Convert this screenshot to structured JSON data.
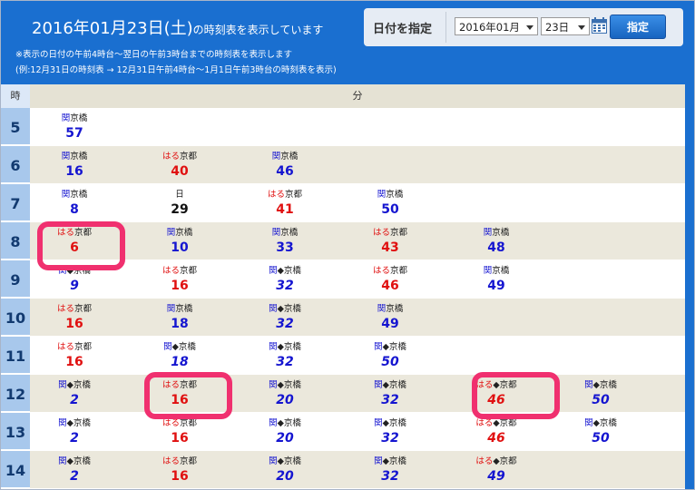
{
  "header": {
    "title_date": "2016年01月23日(土)",
    "title_suffix": "の時刻表を表示しています",
    "note1": "※表示の日付の午前4時台～翌日の午前3時台までの時刻表を表示します",
    "note2": "(例:12月31日の時刻表 → 12月31日午前4時台～1月1日午前3時台の時刻表を表示)"
  },
  "date_picker": {
    "label": "日付を指定",
    "month_value": "2016年01月",
    "day_value": "23日",
    "button_label": "指定"
  },
  "table": {
    "hour_header": "時",
    "minute_header": "分",
    "rows": [
      {
        "hour": "5",
        "entries": [
          {
            "label": "関京橋",
            "minute": "57",
            "label_type": "kansai",
            "minute_color": "blue",
            "italic": false
          }
        ]
      },
      {
        "hour": "6",
        "entries": [
          {
            "label": "関京橋",
            "minute": "16",
            "label_type": "kansai",
            "minute_color": "blue",
            "italic": false
          },
          {
            "label": "はる京都",
            "minute": "40",
            "label_type": "haruka",
            "minute_color": "red",
            "italic": false
          },
          {
            "label": "関京橋",
            "minute": "46",
            "label_type": "kansai",
            "minute_color": "blue",
            "italic": false
          }
        ]
      },
      {
        "hour": "7",
        "entries": [
          {
            "label": "関京橋",
            "minute": "8",
            "label_type": "kansai",
            "minute_color": "blue",
            "italic": false
          },
          {
            "label": "日",
            "minute": "29",
            "label_type": "plain",
            "minute_color": "black",
            "italic": false
          },
          {
            "label": "はる京都",
            "minute": "41",
            "label_type": "haruka",
            "minute_color": "red",
            "italic": false
          },
          {
            "label": "関京橋",
            "minute": "50",
            "label_type": "kansai",
            "minute_color": "blue",
            "italic": false
          }
        ]
      },
      {
        "hour": "8",
        "entries": [
          {
            "label": "はる京都",
            "minute": "6",
            "label_type": "haruka",
            "minute_color": "red",
            "italic": false
          },
          {
            "label": "関京橋",
            "minute": "10",
            "label_type": "kansai",
            "minute_color": "blue",
            "italic": false
          },
          {
            "label": "関京橋",
            "minute": "33",
            "label_type": "kansai",
            "minute_color": "blue",
            "italic": false
          },
          {
            "label": "はる京都",
            "minute": "43",
            "label_type": "haruka",
            "minute_color": "red",
            "italic": false
          },
          {
            "label": "関京橋",
            "minute": "48",
            "label_type": "kansai",
            "minute_color": "blue",
            "italic": false
          }
        ]
      },
      {
        "hour": "9",
        "entries": [
          {
            "label": "関◆京橋",
            "minute": "9",
            "label_type": "kansai",
            "minute_color": "blue",
            "italic": true
          },
          {
            "label": "はる京都",
            "minute": "16",
            "label_type": "haruka",
            "minute_color": "red",
            "italic": false
          },
          {
            "label": "関◆京橋",
            "minute": "32",
            "label_type": "kansai",
            "minute_color": "blue",
            "italic": true
          },
          {
            "label": "はる京都",
            "minute": "46",
            "label_type": "haruka",
            "minute_color": "red",
            "italic": false
          },
          {
            "label": "関京橋",
            "minute": "49",
            "label_type": "kansai",
            "minute_color": "blue",
            "italic": false
          }
        ]
      },
      {
        "hour": "10",
        "entries": [
          {
            "label": "はる京都",
            "minute": "16",
            "label_type": "haruka",
            "minute_color": "red",
            "italic": false
          },
          {
            "label": "関京橋",
            "minute": "18",
            "label_type": "kansai",
            "minute_color": "blue",
            "italic": false
          },
          {
            "label": "関◆京橋",
            "minute": "32",
            "label_type": "kansai",
            "minute_color": "blue",
            "italic": true
          },
          {
            "label": "関京橋",
            "minute": "49",
            "label_type": "kansai",
            "minute_color": "blue",
            "italic": false
          }
        ]
      },
      {
        "hour": "11",
        "entries": [
          {
            "label": "はる京都",
            "minute": "16",
            "label_type": "haruka",
            "minute_color": "red",
            "italic": false
          },
          {
            "label": "関◆京橋",
            "minute": "18",
            "label_type": "kansai",
            "minute_color": "blue",
            "italic": true
          },
          {
            "label": "関◆京橋",
            "minute": "32",
            "label_type": "kansai",
            "minute_color": "blue",
            "italic": true
          },
          {
            "label": "関◆京橋",
            "minute": "50",
            "label_type": "kansai",
            "minute_color": "blue",
            "italic": true
          }
        ]
      },
      {
        "hour": "12",
        "entries": [
          {
            "label": "関◆京橋",
            "minute": "2",
            "label_type": "kansai",
            "minute_color": "blue",
            "italic": true
          },
          {
            "label": "はる京都",
            "minute": "16",
            "label_type": "haruka",
            "minute_color": "red",
            "italic": false
          },
          {
            "label": "関◆京橋",
            "minute": "20",
            "label_type": "kansai",
            "minute_color": "blue",
            "italic": true
          },
          {
            "label": "関◆京橋",
            "minute": "32",
            "label_type": "kansai",
            "minute_color": "blue",
            "italic": true
          },
          {
            "label": "はる◆京都",
            "minute": "46",
            "label_type": "haruka",
            "minute_color": "red",
            "italic": true
          },
          {
            "label": "関◆京橋",
            "minute": "50",
            "label_type": "kansai",
            "minute_color": "blue",
            "italic": true
          }
        ]
      },
      {
        "hour": "13",
        "entries": [
          {
            "label": "関◆京橋",
            "minute": "2",
            "label_type": "kansai",
            "minute_color": "blue",
            "italic": true
          },
          {
            "label": "はる京都",
            "minute": "16",
            "label_type": "haruka",
            "minute_color": "red",
            "italic": false
          },
          {
            "label": "関◆京橋",
            "minute": "20",
            "label_type": "kansai",
            "minute_color": "blue",
            "italic": true
          },
          {
            "label": "関◆京橋",
            "minute": "32",
            "label_type": "kansai",
            "minute_color": "blue",
            "italic": true
          },
          {
            "label": "はる◆京都",
            "minute": "46",
            "label_type": "haruka",
            "minute_color": "red",
            "italic": true
          },
          {
            "label": "関◆京橋",
            "minute": "50",
            "label_type": "kansai",
            "minute_color": "blue",
            "italic": true
          }
        ]
      },
      {
        "hour": "14",
        "entries": [
          {
            "label": "関◆京橋",
            "minute": "2",
            "label_type": "kansai",
            "minute_color": "blue",
            "italic": true
          },
          {
            "label": "はる京都",
            "minute": "16",
            "label_type": "haruka",
            "minute_color": "red",
            "italic": false
          },
          {
            "label": "関◆京橋",
            "minute": "20",
            "label_type": "kansai",
            "minute_color": "blue",
            "italic": true
          },
          {
            "label": "関◆京橋",
            "minute": "32",
            "label_type": "kansai",
            "minute_color": "blue",
            "italic": true
          },
          {
            "label": "はる◆京都",
            "minute": "49",
            "label_type": "haruka",
            "minute_color": "blue",
            "italic": true
          }
        ]
      }
    ]
  },
  "highlights": [
    {
      "row": 6,
      "col": 0
    },
    {
      "row": 7,
      "col": 1
    },
    {
      "row": 7,
      "col": 4
    }
  ],
  "colors": {
    "header_blue": "#1a6fd0",
    "hour_cell_blue": "#a8c8ec",
    "alt_row_beige": "#ebe8dc",
    "minute_blue": "#1515d0",
    "minute_red": "#e01010",
    "highlight_pink": "#f0306f"
  }
}
